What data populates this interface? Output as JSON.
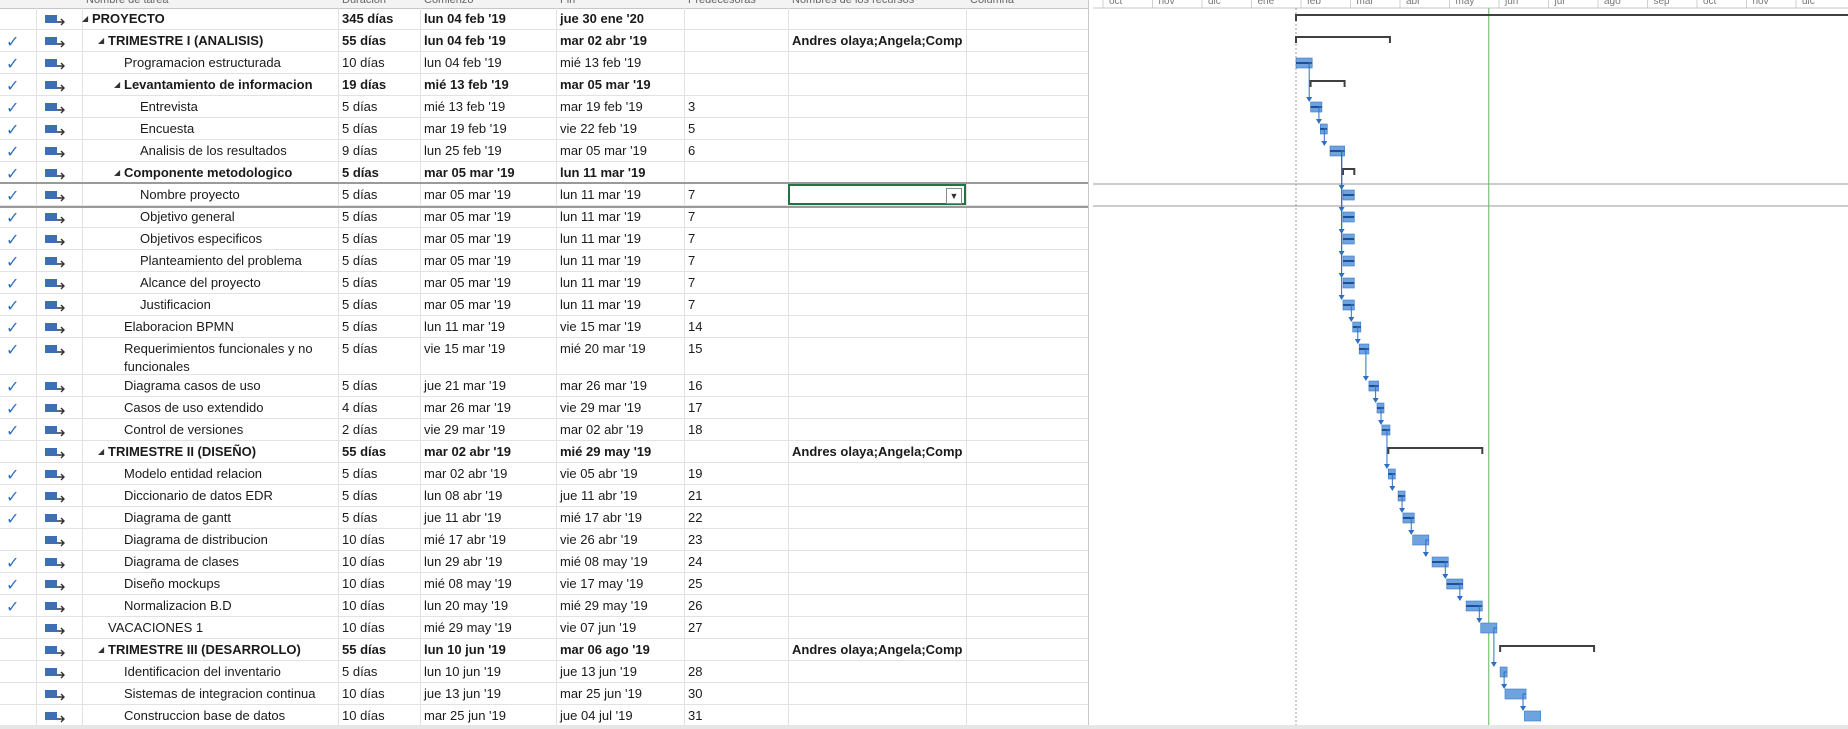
{
  "header": {
    "columns": [
      "",
      "",
      "Nombre de tarea",
      "Duración",
      "Comienzo",
      "Fin",
      "Predecesoras",
      "Nombres de los recursos",
      "Columna"
    ]
  },
  "timescale": [
    "oct",
    "nov",
    "dic",
    "ene",
    "feb",
    "mar",
    "abr",
    "may",
    "jun",
    "jul",
    "ago",
    "sep",
    "oct",
    "nov",
    "dic"
  ],
  "selected_row": 8,
  "tasks": [
    {
      "name": "PROYECTO",
      "duration": "345 días",
      "start": "lun 04 feb '19",
      "finish": "jue 30 ene '20",
      "predecessors": "",
      "resources": "",
      "level": 0,
      "summary": true,
      "done": false
    },
    {
      "name": "TRIMESTRE I (ANALISIS)",
      "duration": "55 días",
      "start": "lun 04 feb '19",
      "finish": "mar 02 abr '19",
      "predecessors": "",
      "resources": "Andres olaya;Angela;Comp",
      "level": 1,
      "summary": true,
      "done": true
    },
    {
      "name": "Programacion estructurada",
      "duration": "10 días",
      "start": "lun 04 feb '19",
      "finish": "mié 13 feb '19",
      "predecessors": "",
      "resources": "",
      "level": 2,
      "summary": false,
      "done": true
    },
    {
      "name": "Levantamiento de informacion",
      "duration": "19 días",
      "start": "mié 13 feb '19",
      "finish": "mar 05 mar '19",
      "predecessors": "",
      "resources": "",
      "level": 2,
      "summary": true,
      "done": true
    },
    {
      "name": "Entrevista",
      "duration": "5 días",
      "start": "mié 13 feb '19",
      "finish": "mar 19 feb '19",
      "predecessors": "3",
      "resources": "",
      "level": 3,
      "summary": false,
      "done": true
    },
    {
      "name": "Encuesta",
      "duration": "5 días",
      "start": "mar 19 feb '19",
      "finish": "vie 22 feb '19",
      "predecessors": "5",
      "resources": "",
      "level": 3,
      "summary": false,
      "done": true
    },
    {
      "name": "Analisis de los resultados",
      "duration": "9 días",
      "start": "lun 25 feb '19",
      "finish": "mar 05 mar '19",
      "predecessors": "6",
      "resources": "",
      "level": 3,
      "summary": false,
      "done": true
    },
    {
      "name": "Componente metodologico",
      "duration": "5 días",
      "start": "mar 05 mar '19",
      "finish": "lun 11 mar '19",
      "predecessors": "",
      "resources": "",
      "level": 2,
      "summary": true,
      "done": true
    },
    {
      "name": "Nombre proyecto",
      "duration": "5 días",
      "start": "mar 05 mar '19",
      "finish": "lun 11 mar '19",
      "predecessors": "7",
      "resources": "",
      "level": 3,
      "summary": false,
      "done": true
    },
    {
      "name": "Objetivo general",
      "duration": "5 días",
      "start": "mar 05 mar '19",
      "finish": "lun 11 mar '19",
      "predecessors": "7",
      "resources": "",
      "level": 3,
      "summary": false,
      "done": true
    },
    {
      "name": "Objetivos especificos",
      "duration": "5 días",
      "start": "mar 05 mar '19",
      "finish": "lun 11 mar '19",
      "predecessors": "7",
      "resources": "",
      "level": 3,
      "summary": false,
      "done": true
    },
    {
      "name": "Planteamiento del problema",
      "duration": "5 días",
      "start": "mar 05 mar '19",
      "finish": "lun 11 mar '19",
      "predecessors": "7",
      "resources": "",
      "level": 3,
      "summary": false,
      "done": true
    },
    {
      "name": "Alcance del proyecto",
      "duration": "5 días",
      "start": "mar 05 mar '19",
      "finish": "lun 11 mar '19",
      "predecessors": "7",
      "resources": "",
      "level": 3,
      "summary": false,
      "done": true
    },
    {
      "name": "Justificacion",
      "duration": "5 días",
      "start": "mar 05 mar '19",
      "finish": "lun 11 mar '19",
      "predecessors": "7",
      "resources": "",
      "level": 3,
      "summary": false,
      "done": true
    },
    {
      "name": "Elaboracion BPMN",
      "duration": "5 días",
      "start": "lun 11 mar '19",
      "finish": "vie 15 mar '19",
      "predecessors": "14",
      "resources": "",
      "level": 2,
      "summary": false,
      "done": true
    },
    {
      "name": "Requerimientos funcionales y no funcionales",
      "duration": "5 días",
      "start": "vie 15 mar '19",
      "finish": "mié 20 mar '19",
      "predecessors": "15",
      "resources": "",
      "level": 2,
      "summary": false,
      "done": true,
      "tall": true
    },
    {
      "name": "Diagrama casos de uso",
      "duration": "5 días",
      "start": "jue 21 mar '19",
      "finish": "mar 26 mar '19",
      "predecessors": "16",
      "resources": "",
      "level": 2,
      "summary": false,
      "done": true
    },
    {
      "name": "Casos de uso extendido",
      "duration": "4 días",
      "start": "mar 26 mar '19",
      "finish": "vie 29 mar '19",
      "predecessors": "17",
      "resources": "",
      "level": 2,
      "summary": false,
      "done": true
    },
    {
      "name": "Control de versiones",
      "duration": "2 días",
      "start": "vie 29 mar '19",
      "finish": "mar 02 abr '19",
      "predecessors": "18",
      "resources": "",
      "level": 2,
      "summary": false,
      "done": true
    },
    {
      "name": "TRIMESTRE II (DISEÑO)",
      "duration": "55 días",
      "start": "mar 02 abr '19",
      "finish": "mié 29 may '19",
      "predecessors": "",
      "resources": "Andres olaya;Angela;Comp",
      "level": 1,
      "summary": true,
      "done": false
    },
    {
      "name": "Modelo entidad relacion",
      "duration": "5 días",
      "start": "mar 02 abr '19",
      "finish": "vie 05 abr '19",
      "predecessors": "19",
      "resources": "",
      "level": 2,
      "summary": false,
      "done": true
    },
    {
      "name": "Diccionario de datos EDR",
      "duration": "5 días",
      "start": "lun 08 abr '19",
      "finish": "jue 11 abr '19",
      "predecessors": "21",
      "resources": "",
      "level": 2,
      "summary": false,
      "done": true
    },
    {
      "name": "Diagrama de gantt",
      "duration": "5 días",
      "start": "jue 11 abr '19",
      "finish": "mié 17 abr '19",
      "predecessors": "22",
      "resources": "",
      "level": 2,
      "summary": false,
      "done": true
    },
    {
      "name": "Diagrama de distribucion",
      "duration": "10 días",
      "start": "mié 17 abr '19",
      "finish": "vie 26 abr '19",
      "predecessors": "23",
      "resources": "",
      "level": 2,
      "summary": false,
      "done": false
    },
    {
      "name": "Diagrama de clases",
      "duration": "10 días",
      "start": "lun 29 abr '19",
      "finish": "mié 08 may '19",
      "predecessors": "24",
      "resources": "",
      "level": 2,
      "summary": false,
      "done": true
    },
    {
      "name": "Diseño mockups",
      "duration": "10 días",
      "start": "mié 08 may '19",
      "finish": "vie 17 may '19",
      "predecessors": "25",
      "resources": "",
      "level": 2,
      "summary": false,
      "done": true
    },
    {
      "name": "Normalizacion B.D",
      "duration": "10 días",
      "start": "lun 20 may '19",
      "finish": "mié 29 may '19",
      "predecessors": "26",
      "resources": "",
      "level": 2,
      "summary": false,
      "done": true
    },
    {
      "name": "VACACIONES 1",
      "duration": "10 días",
      "start": "mié 29 may '19",
      "finish": "vie 07 jun '19",
      "predecessors": "27",
      "resources": "",
      "level": 1,
      "summary": false,
      "done": false
    },
    {
      "name": "TRIMESTRE III (DESARROLLO)",
      "duration": "55 días",
      "start": "lun 10 jun '19",
      "finish": "mar 06 ago '19",
      "predecessors": "",
      "resources": "Andres olaya;Angela;Comp",
      "level": 1,
      "summary": true,
      "done": false
    },
    {
      "name": "Identificacion del inventario",
      "duration": "5 días",
      "start": "lun 10 jun '19",
      "finish": "jue 13 jun '19",
      "predecessors": "28",
      "resources": "",
      "level": 2,
      "summary": false,
      "done": false
    },
    {
      "name": "Sistemas de integracion continua",
      "duration": "10 días",
      "start": "jue 13 jun '19",
      "finish": "mar 25 jun '19",
      "predecessors": "30",
      "resources": "",
      "level": 2,
      "summary": false,
      "done": false
    },
    {
      "name": "Construccion base de datos",
      "duration": "10 días",
      "start": "mar 25 jun '19",
      "finish": "jue 04 jul '19",
      "predecessors": "31",
      "resources": "",
      "level": 2,
      "summary": false,
      "done": false
    }
  ],
  "colors": {
    "bar": "#6fa3e0",
    "bar_border": "#3a78c4",
    "summary": "#404040",
    "link": "#2e6fc4",
    "today": "#5cb85c",
    "check": "#2f6fbf"
  }
}
